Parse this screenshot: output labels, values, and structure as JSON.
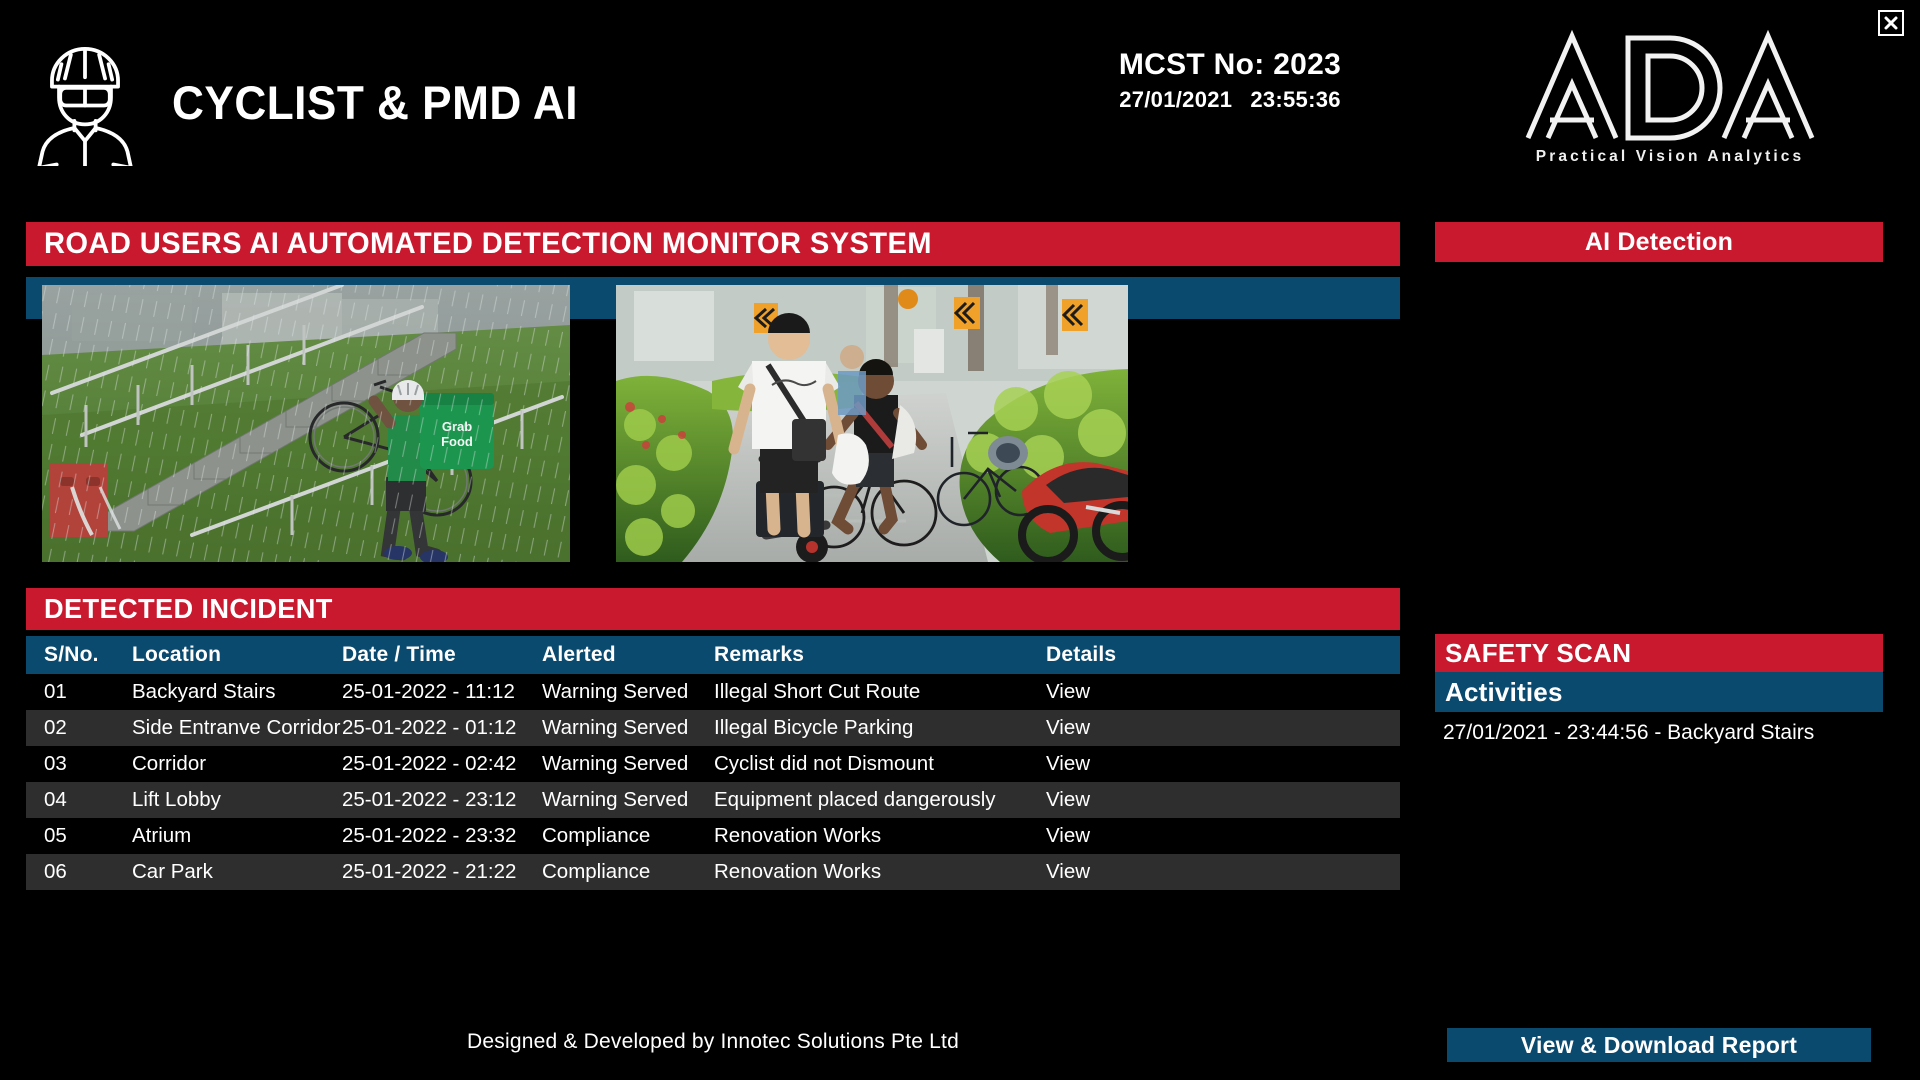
{
  "header": {
    "brand_title": "CYCLIST & PMD AI",
    "cyclist_icon": "cyclist-icon",
    "mcst_label": "MCST No: 2023",
    "date": "27/01/2021",
    "time": "23:55:36",
    "logo_text": "ADA",
    "logo_tagline": "Practical Vision Analytics",
    "close_label": "close-icon"
  },
  "main": {
    "title_banner": "ROAD USERS AI AUTOMATED DETECTION MONITOR SYSTEM",
    "photos": [
      {
        "name": "photo-cyclist-stairs",
        "caption": "GrabFood delivery cyclist carrying bicycle up concrete stairs in heavy rain"
      },
      {
        "name": "photo-pmd-pavement",
        "caption": "E-scooter rider and cyclist on a pavement beside hedges and parked motorcycles"
      }
    ],
    "incident_banner": "DETECTED INCIDENT",
    "columns": [
      "S/No.",
      "Location",
      "Date / Time",
      "Alerted",
      "Remarks",
      "Details"
    ],
    "rows": [
      {
        "sno": "01",
        "location": "Backyard Stairs",
        "datetime": "25-01-2022 - 11:12",
        "alerted": "Warning Served",
        "remarks": "Illegal Short Cut Route",
        "details": "View"
      },
      {
        "sno": "02",
        "location": "Side Entranve Corridor",
        "datetime": "25-01-2022 - 01:12",
        "alerted": "Warning Served",
        "remarks": "Illegal Bicycle Parking",
        "details": "View"
      },
      {
        "sno": "03",
        "location": "Corridor",
        "datetime": "25-01-2022 - 02:42",
        "alerted": "Warning Served",
        "remarks": "Cyclist did not Dismount",
        "details": "View"
      },
      {
        "sno": "04",
        "location": "Lift Lobby",
        "datetime": "25-01-2022 - 23:12",
        "alerted": "Warning Served",
        "remarks": "Equipment placed dangerously",
        "details": "View"
      },
      {
        "sno": "05",
        "location": "Atrium",
        "datetime": "25-01-2022 - 23:32",
        "alerted": "Compliance",
        "remarks": "Renovation Works",
        "details": "View"
      },
      {
        "sno": "06",
        "location": "Car Park",
        "datetime": "25-01-2022 - 21:22",
        "alerted": "Compliance",
        "remarks": "Renovation Works",
        "details": "View"
      }
    ],
    "footer": "Designed & Developed by Innotec Solutions Pte Ltd"
  },
  "sidebar": {
    "ai_detection_label": "AI Detection",
    "safety_scan_label": "SAFETY SCAN",
    "activities_label": "Activities",
    "activities": [
      "27/01/2021 - 23:44:56 - Backyard Stairs"
    ],
    "report_button": "View & Download Report"
  },
  "colors": {
    "accent_red": "#c8192e",
    "accent_blue": "#0b4a6f",
    "background": "#000000",
    "row_alt": "#2e2e2e",
    "text": "#ffffff"
  }
}
